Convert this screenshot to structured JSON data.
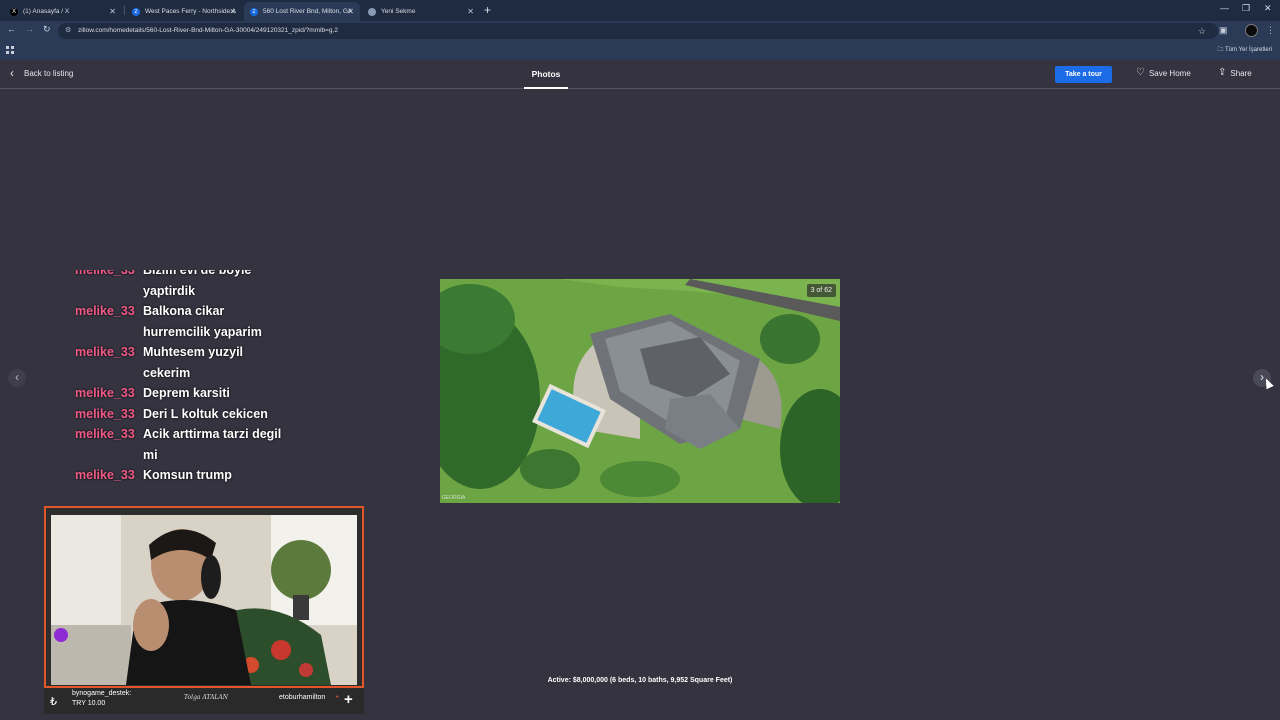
{
  "browser": {
    "tabs": [
      {
        "label": "(1) Anasayfa / X",
        "icon": "x-logo-icon",
        "active": false
      },
      {
        "label": "West Paces Ferry - Northside A",
        "icon": "zillow-icon",
        "active": false
      },
      {
        "label": "560 Lost River Bnd, Milton, GA",
        "icon": "zillow-icon",
        "active": true
      },
      {
        "label": "Yeni Sekme",
        "icon": "chrome-icon",
        "active": false
      }
    ],
    "url": "zillow.com/homedetails/560-Lost-River-Bnd-Milton-GA-30004/249120321_zpid/?mmlb=g,2",
    "bookmarks_all_label": "Tüm Yer İşaretleri"
  },
  "viewer": {
    "back_label": "Back to listing",
    "active_tab": "Photos",
    "tour_label": "Take a tour",
    "save_label": "Save Home",
    "share_label": "Share",
    "photo_counter": "3 of 62",
    "photo_watermark": "GEORGIA",
    "caption": "Active: $8,000,000 (6 beds, 10 baths, 9,952 Square Feet)"
  },
  "chat": [
    {
      "user": "melike_33",
      "text": "Bizim evi de boyle yaptirdik"
    },
    {
      "user": "melike_33",
      "text": "Balkona cikar hurremcilik yaparim"
    },
    {
      "user": "melike_33",
      "text": "Muhtesem yuzyil cekerim"
    },
    {
      "user": "melike_33",
      "text": "Deprem karsiti"
    },
    {
      "user": "melike_33",
      "text": "Deri L koltuk cekicen"
    },
    {
      "user": "melike_33",
      "text": "Acik arttirma tarzi degil mi"
    },
    {
      "user": "melike_33",
      "text": "Komsun trump"
    }
  ],
  "donation": {
    "user": "bynogame_destek:",
    "amount": "TRY 10.00",
    "signature": "Tolga ATALAN",
    "handle": "etoburhamilton"
  },
  "colors": {
    "chat_user": "#ef5a86",
    "cam_border": "#e2562a",
    "tour_button": "#1c6ce8",
    "viewer_bg": "#34333f"
  }
}
